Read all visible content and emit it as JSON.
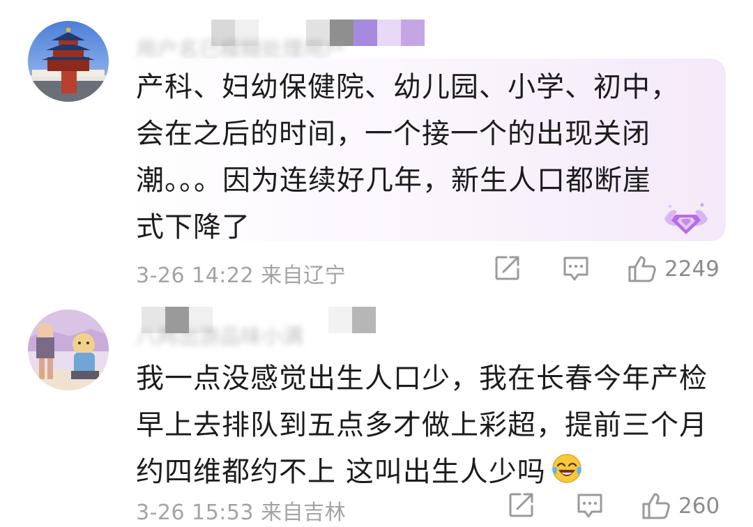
{
  "comments": [
    {
      "text": "产科、妇幼保健院、幼儿园、小学、初中，\n会在之后的时间，一个接一个的出现关闭\n潮。。。因为连续好几年，新生人口都断崖\n式下降了",
      "date": "3-26 14:22",
      "location": "来自辽宁",
      "likes": "2249",
      "avatar_icon": "temple-of-heaven-avatar",
      "badge_icon": "diamond-badge-icon",
      "bubble_color": "#f4e9f8"
    },
    {
      "text": "我一点没感觉出生人口少，我在长春今年产检\n早上去排队到五点多才做上彩超，提前三个月\n约四维都约不上 这叫出生人少吗",
      "emoji": "laughing-crying-emoji",
      "date": "3-26 15:53",
      "location": "来自吉林",
      "likes": "260",
      "avatar_icon": "cartoon-illustration-avatar"
    }
  ],
  "icons": {
    "share": "share-icon",
    "reply": "reply-icon",
    "like": "thumbs-up-icon"
  },
  "colors": {
    "text": "#1c1c1c",
    "meta": "#a3a3a3",
    "badge": "#b66be8"
  }
}
